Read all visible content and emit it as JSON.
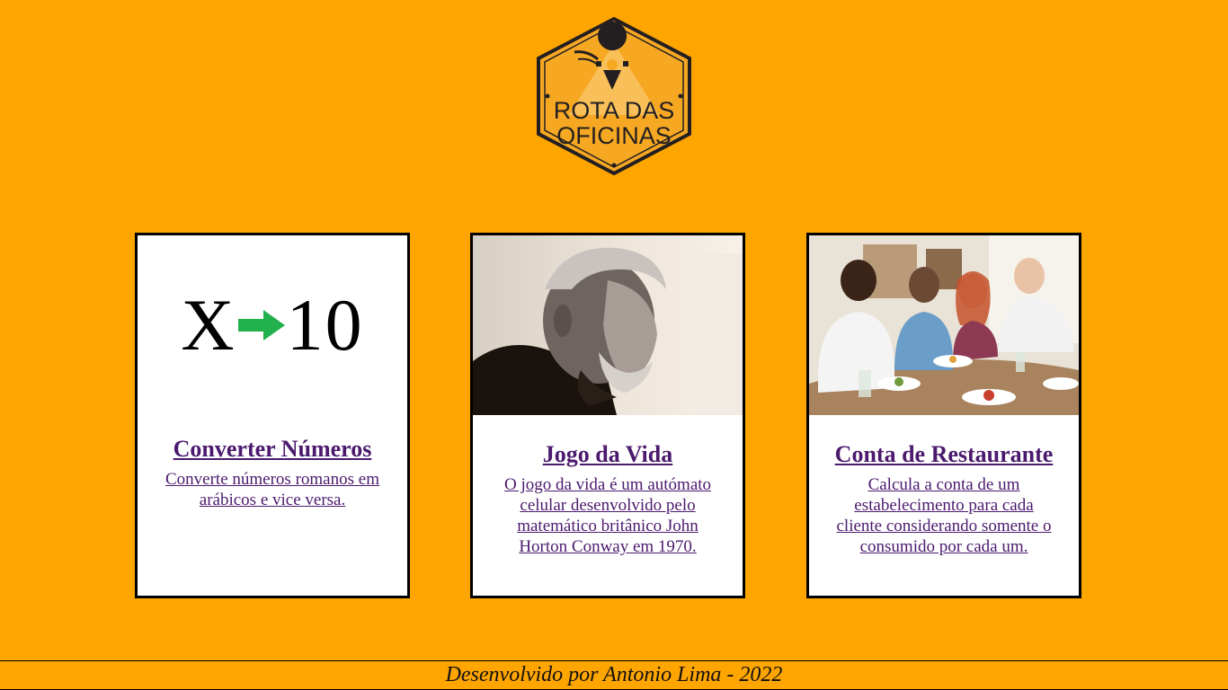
{
  "logo": {
    "line1": "ROTA DAS",
    "line2": "OFICINAS",
    "icon": "gear-pin-icon",
    "colors": {
      "fill": "#F7A823",
      "stroke": "#231F20"
    }
  },
  "cards": [
    {
      "graphic": {
        "left": "X",
        "right": "10",
        "arrow_icon": "arrow-right-icon",
        "arrow_color": "#22B14C"
      },
      "title": "Converter Números",
      "description": "Converte números romanos em arábicos e vice versa."
    },
    {
      "image": "portrait-photo",
      "title": "Jogo da Vida",
      "description": "O jogo da vida é um autómato celular desenvolvido pelo matemático britânico John Horton Conway em 1970."
    },
    {
      "image": "restaurant-group-photo",
      "title": "Conta de Restaurante",
      "description": "Calcula a conta de um estabelecimento para cada cliente considerando somente o consumido por cada um."
    }
  ],
  "footer": {
    "text": "Desenvolvido por Antonio Lima - 2022"
  },
  "colors": {
    "background": "#FFA500",
    "link": "#4B1A6E",
    "card_border": "#000000"
  }
}
